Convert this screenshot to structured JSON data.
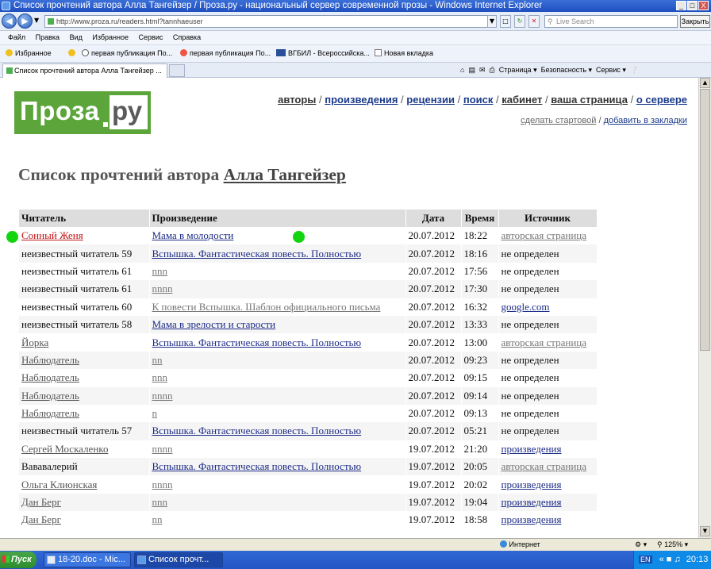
{
  "window": {
    "title": "Список прочтений автора Алла Тангейзер / Проза.ру - национальный сервер современной прозы - Windows Internet Explorer",
    "minimize": "_",
    "maximize": "□",
    "close": "X"
  },
  "addressbar": {
    "url": "http://www.proza.ru/readers.html?tannhaeuser",
    "search_placeholder": "Live Search",
    "close_label": "Закрыть"
  },
  "menu": [
    "Файл",
    "Правка",
    "Вид",
    "Избранное",
    "Сервис",
    "Справка"
  ],
  "favorites": {
    "label": "Избранное",
    "items": [
      "первая публикация По...",
      "первая публикация По...",
      "ВГБИЛ - Всероссийска...",
      "Новая вкладка"
    ]
  },
  "tab": {
    "title": "Список прочтений автора Алла Тангейзер ..."
  },
  "commandbar": [
    "Страница",
    "Безопасность",
    "Сервис"
  ],
  "site": {
    "logo_main": "Проза",
    "logo_ru": "ру",
    "nav": [
      "авторы",
      "произведения",
      "рецензии",
      "поиск",
      "кабинет",
      "ваша страница",
      "о сервере"
    ],
    "subnav": [
      "сделать стартовой",
      "добавить в закладки"
    ]
  },
  "page": {
    "heading_prefix": "Список прочтений автора",
    "author": "Алла Тангейзер"
  },
  "table": {
    "headers": [
      "Читатель",
      "Произведение",
      "Дата",
      "Время",
      "Источник"
    ],
    "rows": [
      {
        "reader": "Сонный Женя",
        "work": "Мама в молодости",
        "date": "20.07.2012",
        "time": "18:22",
        "source": "авторская страница"
      },
      {
        "reader": "неизвестный читатель 59",
        "work": "Вспышка. Фантастическая повесть. Полностью",
        "date": "20.07.2012",
        "time": "18:16",
        "source": "не определен"
      },
      {
        "reader": "неизвестный читатель 61",
        "work": "nnn",
        "date": "20.07.2012",
        "time": "17:56",
        "source": "не определен"
      },
      {
        "reader": "неизвестный читатель 61",
        "work": "nnnn",
        "date": "20.07.2012",
        "time": "17:30",
        "source": "не определен"
      },
      {
        "reader": "неизвестный читатель 60",
        "work": "К повести Вспышка. Шаблон официального письма",
        "date": "20.07.2012",
        "time": "16:32",
        "source": "google.com"
      },
      {
        "reader": "неизвестный читатель 58",
        "work": "Мама в зрелости и старости",
        "date": "20.07.2012",
        "time": "13:33",
        "source": "не определен"
      },
      {
        "reader": "Йорка",
        "work": "Вспышка. Фантастическая повесть. Полностью",
        "date": "20.07.2012",
        "time": "13:00",
        "source": "авторская страница"
      },
      {
        "reader": "Наблюдатель",
        "work": "nn",
        "date": "20.07.2012",
        "time": "09:23",
        "source": "не определен"
      },
      {
        "reader": "Наблюдатель",
        "work": "nnn",
        "date": "20.07.2012",
        "time": "09:15",
        "source": "не определен"
      },
      {
        "reader": "Наблюдатель",
        "work": "nnnn",
        "date": "20.07.2012",
        "time": "09:14",
        "source": "не определен"
      },
      {
        "reader": "Наблюдатель",
        "work": "n",
        "date": "20.07.2012",
        "time": "09:13",
        "source": "не определен"
      },
      {
        "reader": "неизвестный читатель 57",
        "work": "Вспышка. Фантастическая повесть. Полностью",
        "date": "20.07.2012",
        "time": "05:21",
        "source": "не определен"
      },
      {
        "reader": "Сергей Москаленко",
        "work": "nnnn",
        "date": "19.07.2012",
        "time": "21:20",
        "source": "произведения"
      },
      {
        "reader": "Вававалерий",
        "work": "Вспышка. Фантастическая повесть. Полностью",
        "date": "19.07.2012",
        "time": "20:05",
        "source": "авторская страница"
      },
      {
        "reader": "Ольга Клионская",
        "work": "nnnn",
        "date": "19.07.2012",
        "time": "20:02",
        "source": "произведения"
      },
      {
        "reader": "Дан Берг",
        "work": "nnn",
        "date": "19.07.2012",
        "time": "19:04",
        "source": "произведения"
      },
      {
        "reader": "Дан Берг",
        "work": "nn",
        "date": "19.07.2012",
        "time": "18:58",
        "source": "произведения"
      }
    ]
  },
  "statusbar": {
    "zone": "Интернет",
    "zoom": "125%"
  },
  "taskbar": {
    "start": "Пуск",
    "items": [
      "18-20.doc - Mic...",
      "Список прочт..."
    ],
    "lang": "EN",
    "clock": "20:13"
  }
}
